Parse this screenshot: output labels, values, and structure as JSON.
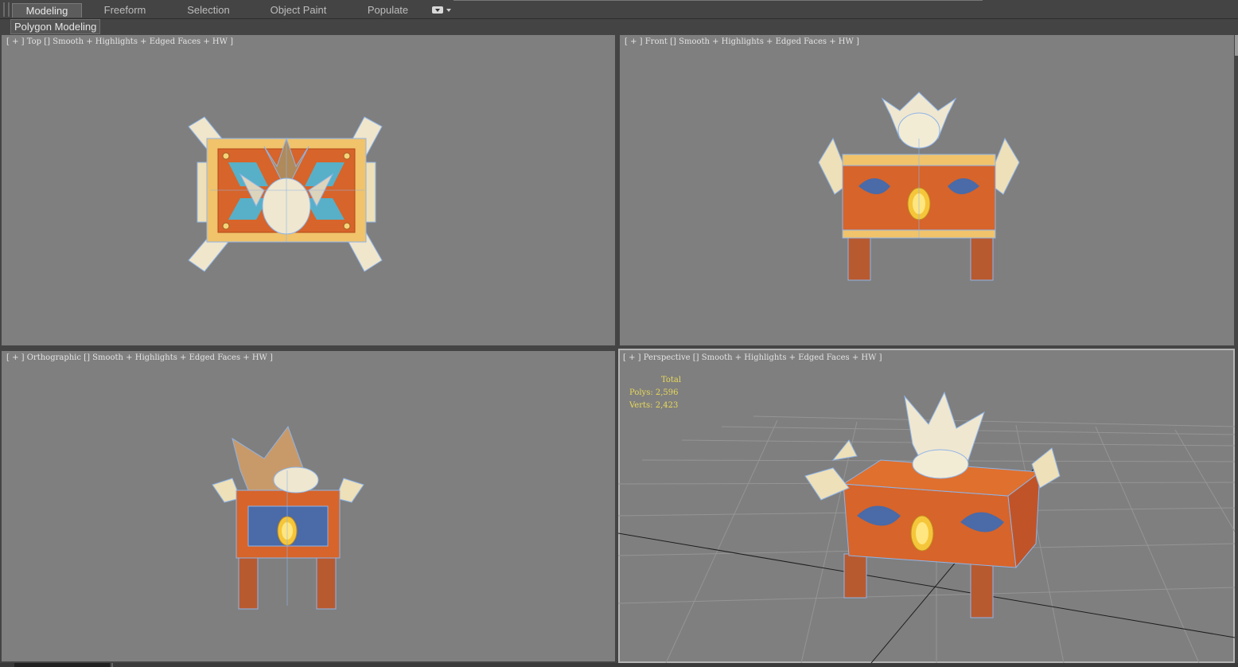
{
  "ribbon": {
    "tabs": [
      {
        "label": "Modeling",
        "active": true
      },
      {
        "label": "Freeform",
        "active": false
      },
      {
        "label": "Selection",
        "active": false
      },
      {
        "label": "Object Paint",
        "active": false
      },
      {
        "label": "Populate",
        "active": false
      }
    ],
    "dropdown_icon": "dropdown-icon"
  },
  "panel": {
    "label": "Polygon Modeling"
  },
  "viewports": {
    "top": {
      "plus": "[ + ]",
      "view": "Top",
      "shading": "Smooth + Highlights + Edged Faces + HW ]"
    },
    "front": {
      "plus": "[ + ]",
      "view": "Front",
      "shading": "Smooth + Highlights + Edged Faces + HW ]"
    },
    "ortho": {
      "plus": "[ + ]",
      "view": "Orthographic",
      "shading": "Smooth + Highlights + Edged Faces + HW ]"
    },
    "persp": {
      "plus": "[ + ]",
      "view": "Perspective",
      "shading": "Smooth + Highlights + Edged Faces + HW ]"
    }
  },
  "stats": {
    "header": "Total",
    "polys_label": "Polys:",
    "polys": "2,596",
    "verts_label": "Verts:",
    "verts": "2,423"
  },
  "colors": {
    "viewport_bg": "#7f7f7f",
    "ui_bg": "#444444",
    "stats_text": "#e8d85a",
    "chest_orange": "#d7642a",
    "chest_gold": "#f1c36b",
    "dragon_white": "#f1ecd8",
    "panel_blue": "#4a6aa8"
  }
}
